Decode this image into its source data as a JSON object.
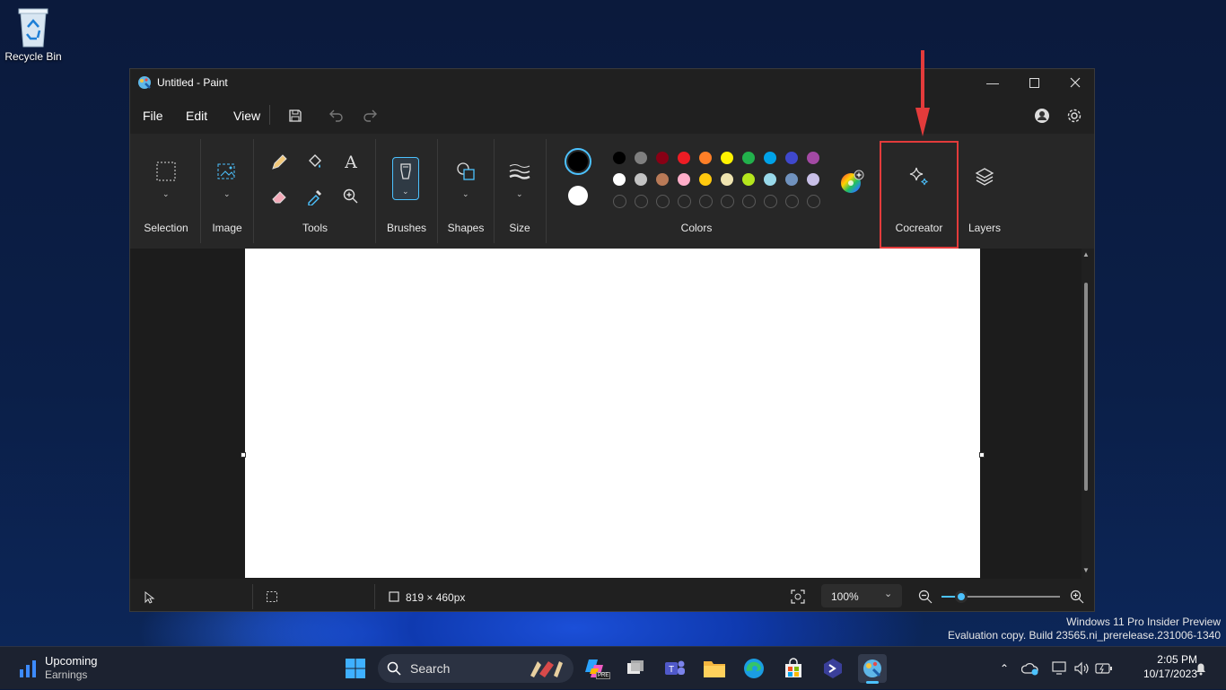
{
  "desktop": {
    "recycle_bin_label": "Recycle Bin",
    "watermark_line1": "Windows 11 Pro Insider Preview",
    "watermark_line2": "Evaluation copy. Build 23565.ni_prerelease.231006-1340"
  },
  "window": {
    "title": "Untitled - Paint",
    "controls": [
      "minimize-icon",
      "maximize-icon",
      "close-icon"
    ]
  },
  "menubar": {
    "file_label": "File",
    "edit_label": "Edit",
    "view_label": "View"
  },
  "ribbon": {
    "selection_label": "Selection",
    "image_label": "Image",
    "tools_label": "Tools",
    "brushes_label": "Brushes",
    "shapes_label": "Shapes",
    "size_label": "Size",
    "colors_label": "Colors",
    "cocreator_label": "Cocreator",
    "layers_label": "Layers",
    "primary_color": "#000000",
    "secondary_color": "#ffffff",
    "palette_row1": [
      "#000000",
      "#7f7f7f",
      "#880015",
      "#ed1c24",
      "#ff7f27",
      "#fff200",
      "#22b14c",
      "#00a2e8",
      "#3f48cc",
      "#a349a4"
    ],
    "palette_row2": [
      "#ffffff",
      "#c3c3c3",
      "#b97a57",
      "#ffaec9",
      "#ffc90e",
      "#efe4b0",
      "#b5e61d",
      "#99d9ea",
      "#7092be",
      "#c8bfe7"
    ],
    "palette_row3_empty_count": 10
  },
  "statusbar": {
    "canvas_size": "819 × 460px",
    "zoom_level": "100%",
    "zoom_slider_fraction": 0.17
  },
  "taskbar": {
    "widget_title": "Upcoming",
    "widget_subtitle": "Earnings",
    "search_placeholder": "Search",
    "time": "2:05 PM",
    "date": "10/17/2023",
    "copilot_badge": "PRE"
  },
  "colors": {
    "accent": "#4cc2ff",
    "highlight": "#e33b3b"
  }
}
